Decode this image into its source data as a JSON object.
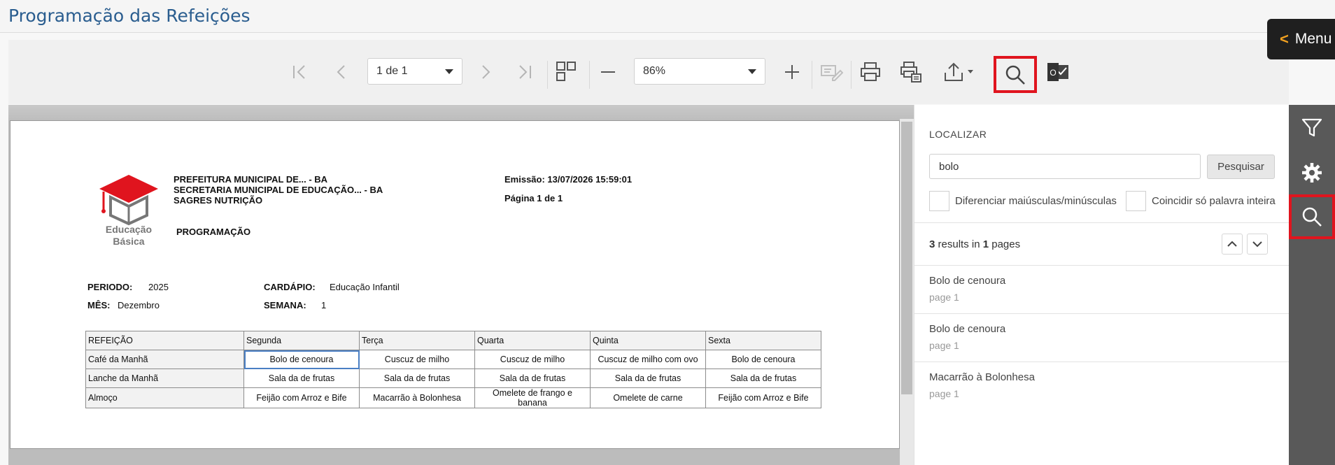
{
  "app": {
    "title": "Programação das Refeições"
  },
  "menu": {
    "label": "Menu"
  },
  "toolbar": {
    "page_select": "1 de 1",
    "zoom_select": "86%",
    "icons": [
      "first-page-icon",
      "prev-page-icon",
      "next-page-icon",
      "last-page-icon",
      "view-mode-icon",
      "zoom-out-icon",
      "zoom-in-icon",
      "edit-icon",
      "print-icon",
      "print-options-icon",
      "export-icon",
      "search-icon",
      "outlook-icon"
    ],
    "outlook_badge": "O"
  },
  "report": {
    "header_lines": [
      "PREFEITURA MUNICIPAL DE... - BA",
      "SECRETARIA MUNICIPAL DE EDUCAÇÃO... - BA",
      "SAGRES NUTRIÇÃO"
    ],
    "emission": "Emissão: 13/07/2026 15:59:01",
    "page_info": "Página 1 de 1",
    "section_title": "PROGRAMAÇÃO",
    "logo_text_1": "Educação",
    "logo_text_2": "Básica",
    "periodo_label": "PERIODO:",
    "periodo_value": "2025",
    "mes_label": "MÊS:",
    "mes_value": "Dezembro",
    "cardapio_label": "CARDÁPIO:",
    "cardapio_value": "Educação Infantil",
    "semana_label": "SEMANA:",
    "semana_value": "1",
    "table": {
      "headers": [
        "REFEIÇÃO",
        "Segunda",
        "Terça",
        "Quarta",
        "Quinta",
        "Sexta"
      ],
      "rows": [
        [
          "Café da Manhã",
          "Bolo de cenoura",
          "Cuscuz de milho",
          "Cuscuz de milho",
          "Cuscuz de milho com ovo",
          "Bolo de cenoura"
        ],
        [
          "Lanche da Manhã",
          "Sala da de frutas",
          "Sala da de frutas",
          "Sala da de frutas",
          "Sala da de frutas",
          "Sala da de frutas"
        ],
        [
          "Almoço",
          "Feijão com Arroz e Bife",
          "Macarrão à Bolonhesa",
          "Omelete de frango e banana",
          "Omelete de carne",
          "Feijão com Arroz e Bife"
        ]
      ]
    }
  },
  "find_panel": {
    "title": "LOCALIZAR",
    "query": "bolo",
    "search_button": "Pesquisar",
    "match_case_label": "Diferenciar maiúsculas/minúsculas",
    "whole_word_label": "Coincidir só palavra inteira",
    "results_count": "3",
    "results_mid": "results in",
    "results_pages": "1",
    "results_suffix": "pages",
    "results": [
      {
        "title": "Bolo de cenoura",
        "page": "page 1"
      },
      {
        "title": "Bolo de cenoura",
        "page": "page 1"
      },
      {
        "title": "Macarrão à Bolonhesa",
        "page": "page 1"
      }
    ]
  },
  "rail": {
    "icons": [
      "filter-icon",
      "gear-icon",
      "search-icon"
    ]
  },
  "colors": {
    "title": "#2a5d8f",
    "highlight": "#e0141e",
    "menu_chevron": "#f0a020",
    "rail": "#595959"
  }
}
